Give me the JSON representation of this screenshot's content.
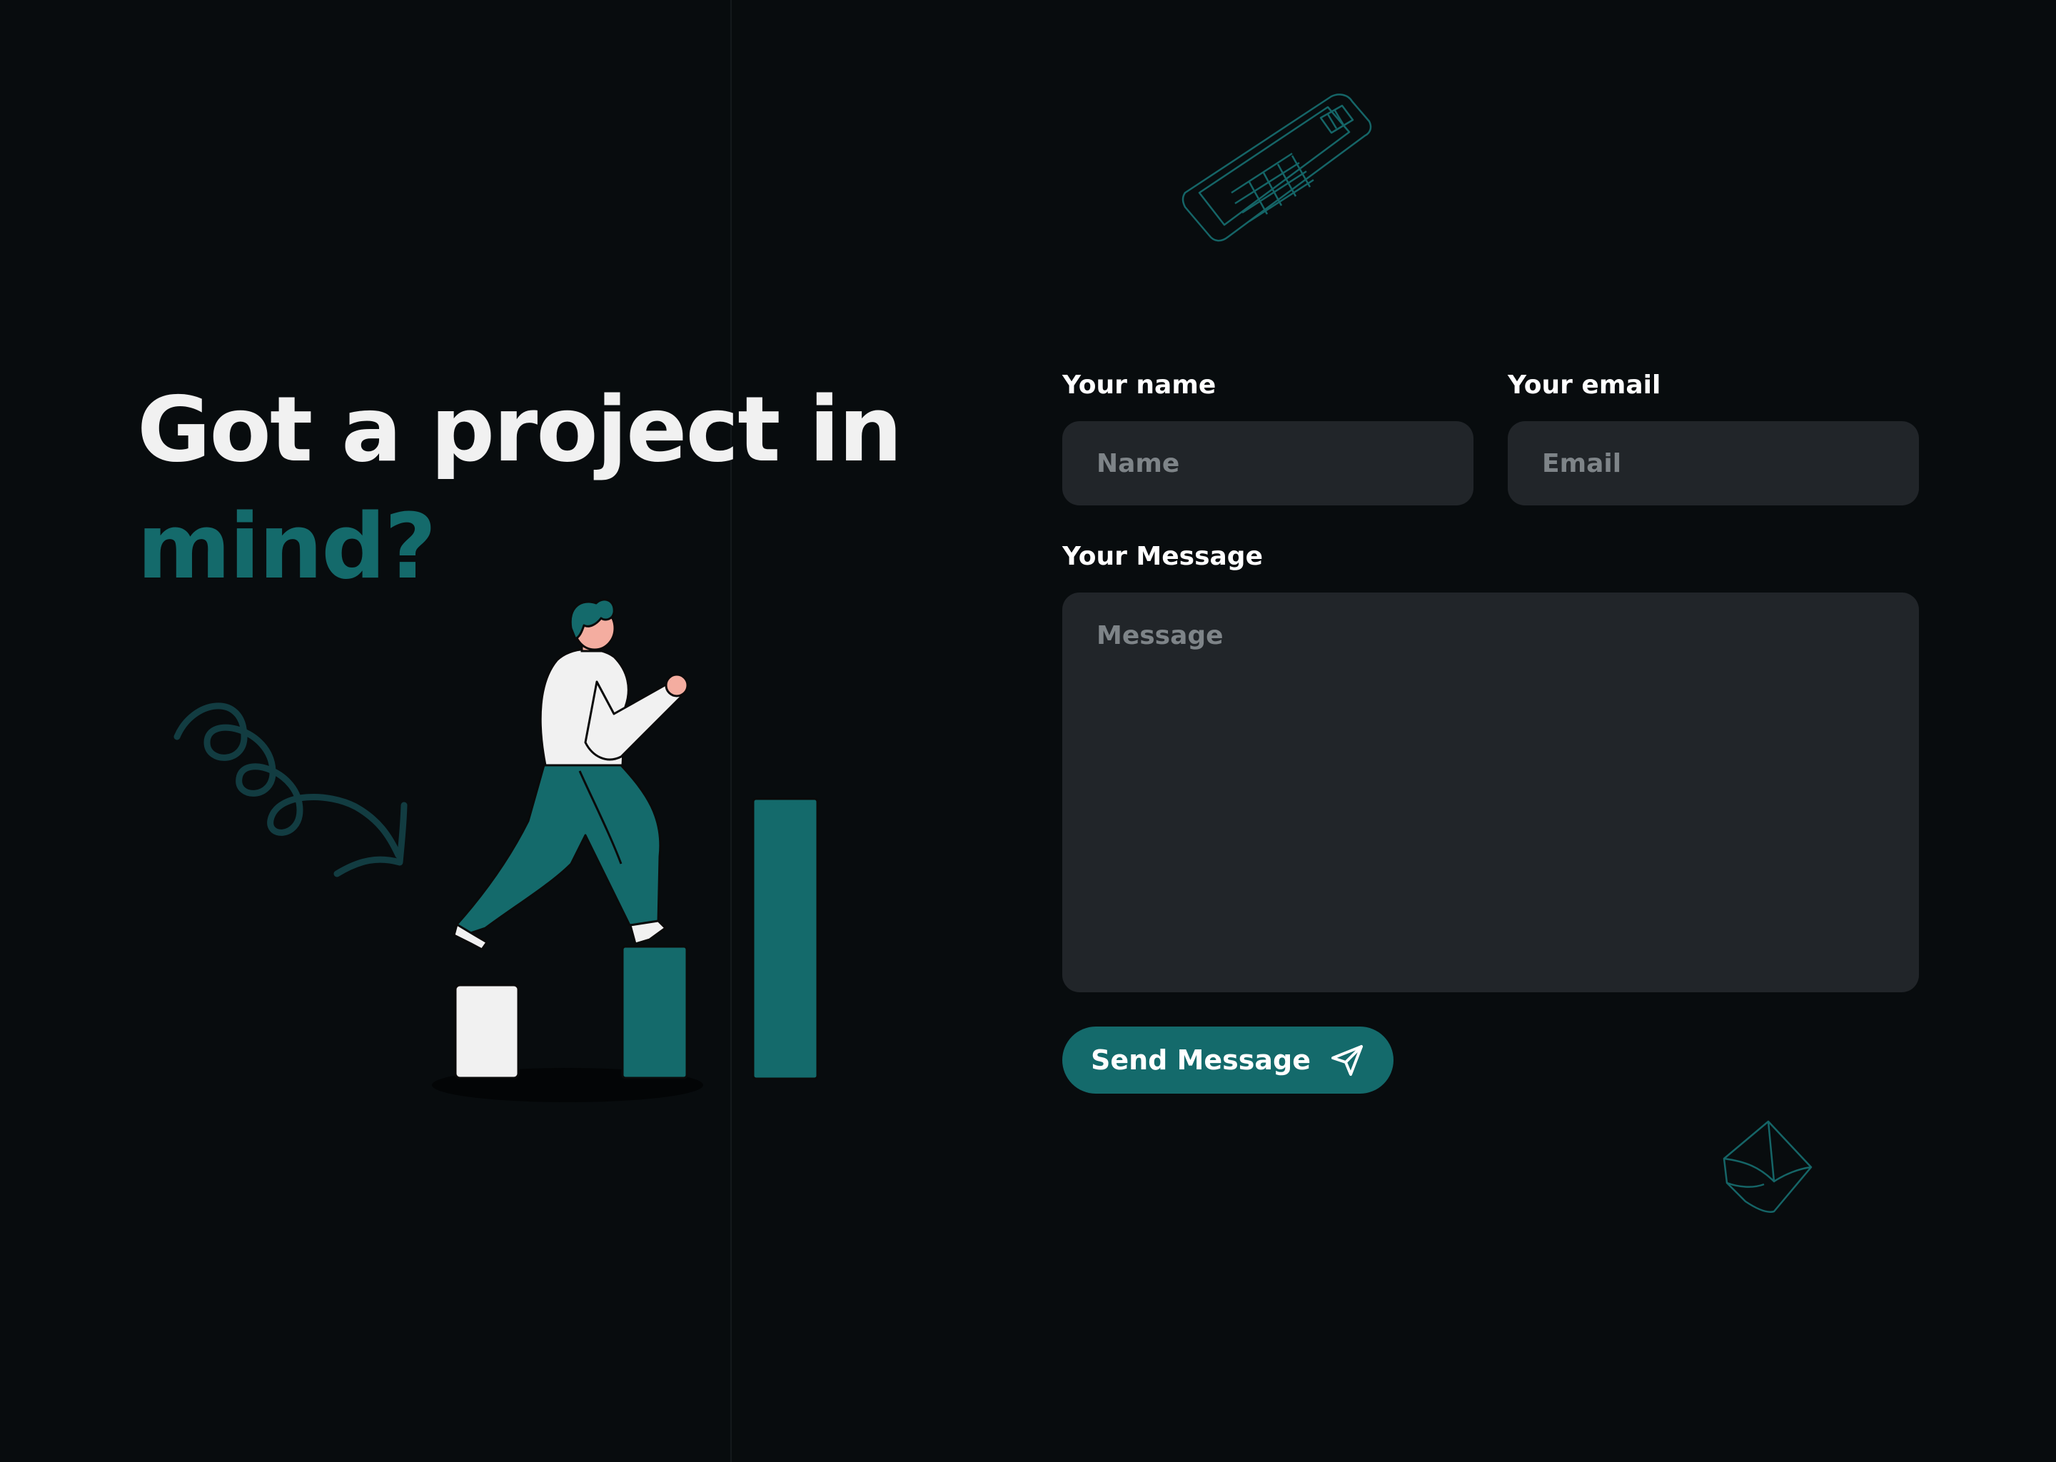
{
  "hero": {
    "title_line1": "Got a project in",
    "title_line2": "mind?"
  },
  "form": {
    "name_label": "Your name",
    "name_placeholder": "Name",
    "name_value": "",
    "email_label": "Your email",
    "email_placeholder": "Email",
    "email_value": "",
    "message_label": "Your Message",
    "message_placeholder": "Message",
    "message_value": "",
    "submit_label": "Send Message"
  },
  "icons": {
    "submit": "send-icon",
    "doodle_top": "keyboard-sketch-icon",
    "doodle_bottom": "envelope-sketch-icon",
    "doodle_left": "curly-arrow-icon"
  },
  "colors": {
    "background": "#080c0e",
    "accent": "#146a6b",
    "field_background": "#212529",
    "title_text": "#f1f1f1",
    "placeholder_text": "#7e8488"
  }
}
